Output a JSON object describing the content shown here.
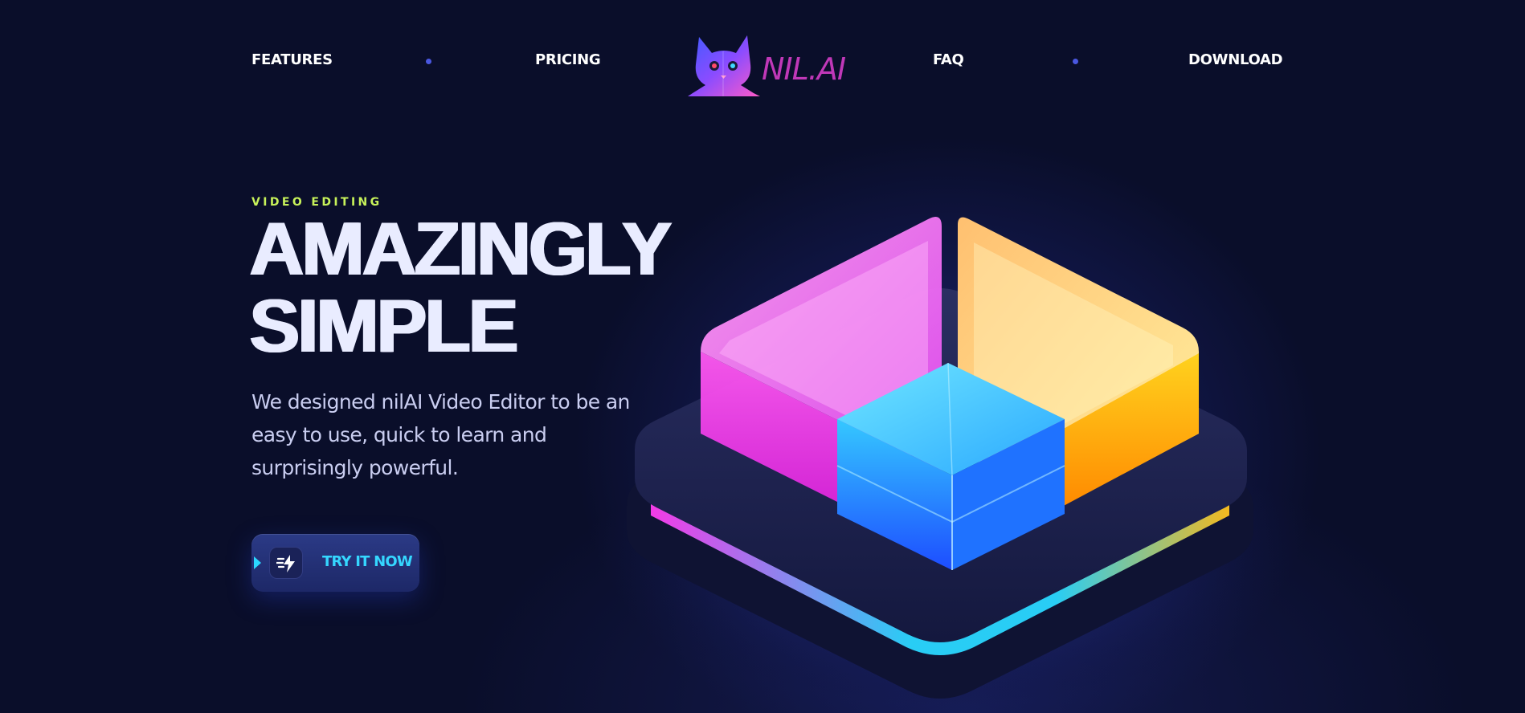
{
  "nav": {
    "items": [
      {
        "label": "FEATURES"
      },
      {
        "label": "PRICING"
      },
      {
        "label": "FAQ"
      },
      {
        "label": "DOWNLOAD"
      }
    ],
    "logo_text": "NIL.AI"
  },
  "hero": {
    "eyebrow": "VIDEO EDITING",
    "headline_line1": "AMAZINGLY",
    "headline_line2": "SIMPLE",
    "description": "We designed nilAI Video Editor to be an easy to use, quick to learn and surprisingly powerful.",
    "cta_label": "TRY IT NOW"
  },
  "icons": {
    "logo": "cat-head-icon",
    "cta": "lightning-icon",
    "cta_play": "play-icon"
  },
  "colors": {
    "background": "#0a0e2a",
    "eyebrow": "#c7f25a",
    "headline": "#e9ecff",
    "cta_text": "#35d7ff",
    "logo_text": "#c038b8",
    "nav_dot": "#4a57e0",
    "block_magenta": "#ff3df0",
    "block_cyan": "#29c8ff",
    "block_orange": "#ffb020"
  }
}
